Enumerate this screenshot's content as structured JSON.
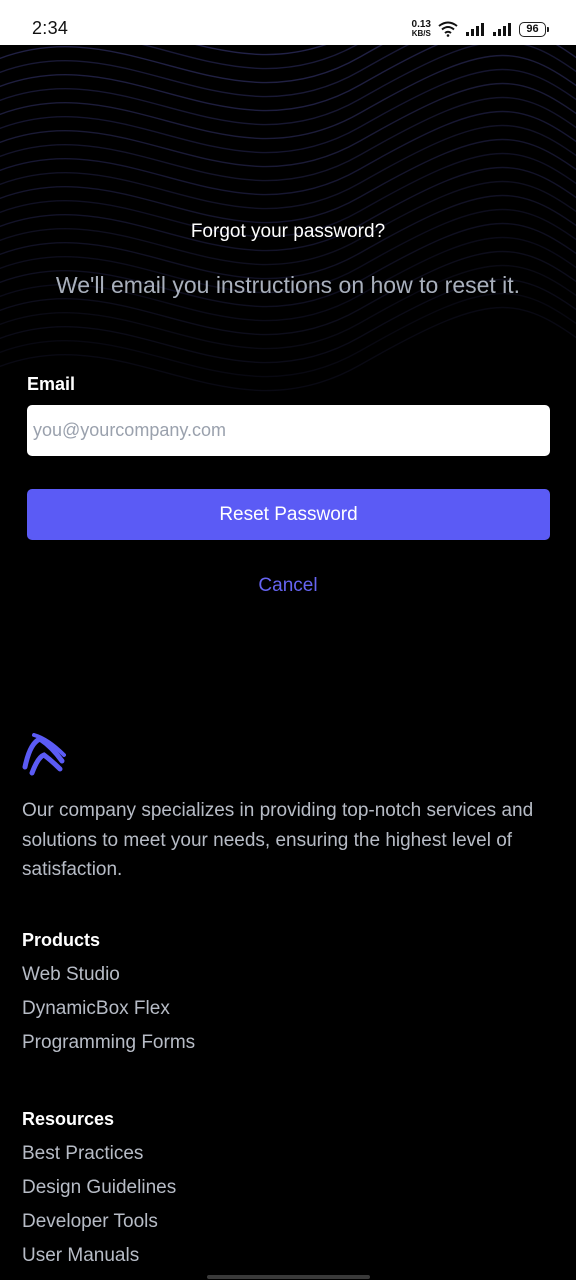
{
  "status_bar": {
    "time": "2:34",
    "net_speed_value": "0.13",
    "net_speed_unit": "KB/S",
    "battery": "96",
    "icons": [
      "wifi-icon",
      "signal-icon",
      "signal-icon"
    ]
  },
  "forgot": {
    "title": "Forgot your password?",
    "subtitle": "We'll email you instructions on how to reset it.",
    "email_label": "Email",
    "email_placeholder": "you@yourcompany.com",
    "email_value": "",
    "reset_button": "Reset Password",
    "cancel_link": "Cancel"
  },
  "footer": {
    "logo_icon": "brand-logo-icon",
    "description": "Our company specializes in providing top-notch services and solutions to meet your needs, ensuring the highest level of satisfaction.",
    "products": {
      "title": "Products",
      "items": [
        "Web Studio",
        "DynamicBox Flex",
        "Programming Forms"
      ]
    },
    "resources": {
      "title": "Resources",
      "items": [
        "Best Practices",
        "Design Guidelines",
        "Developer Tools",
        "User Manuals"
      ]
    }
  },
  "colors": {
    "accent": "#5b5bf5",
    "background": "#000000",
    "link": "#6664f2"
  }
}
